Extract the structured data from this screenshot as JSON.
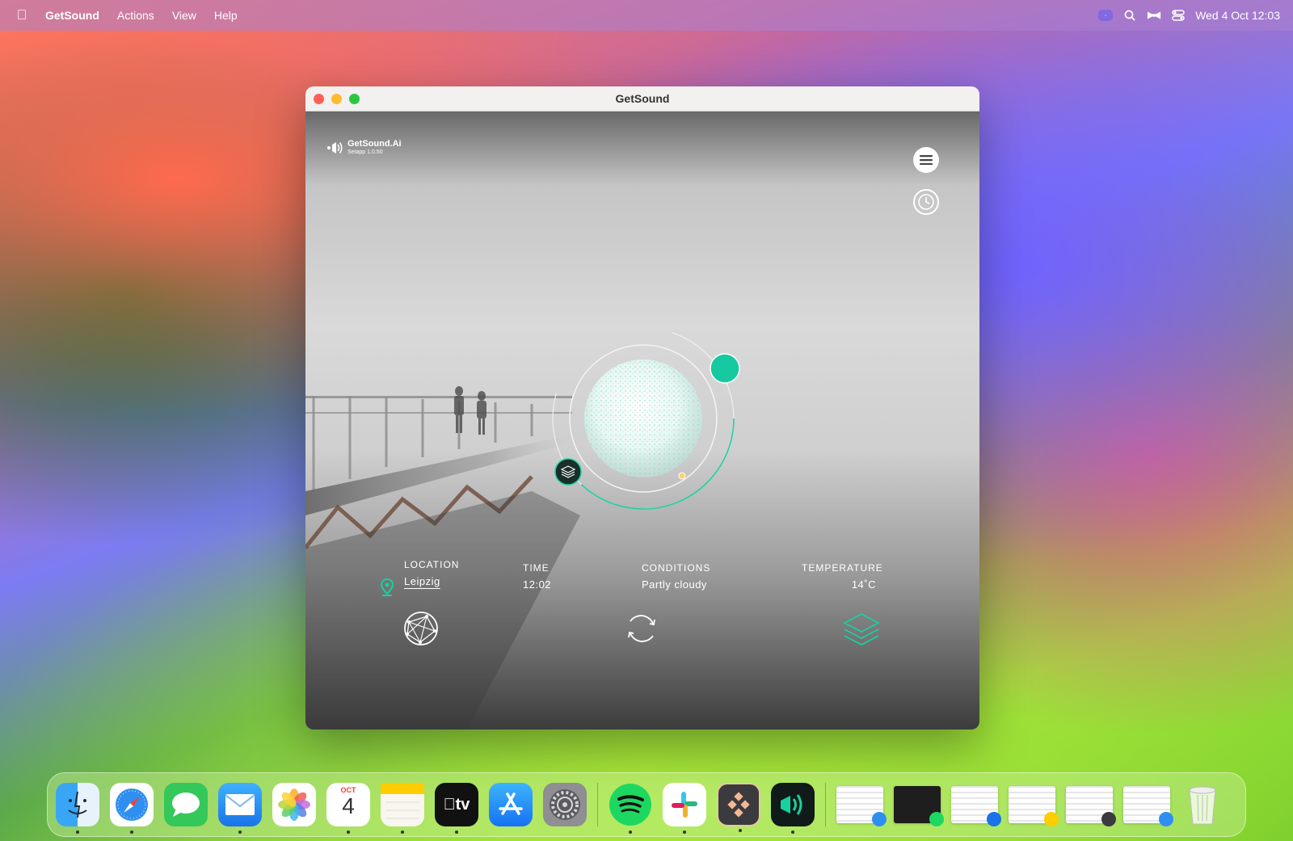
{
  "menubar": {
    "app_name": "GetSound",
    "menus": [
      "Actions",
      "View",
      "Help"
    ],
    "clock": "Wed 4 Oct  12:03"
  },
  "window": {
    "title": "GetSound"
  },
  "app": {
    "brand_name": "GetSound.Ai",
    "brand_version": "Setapp 1.0.50",
    "location": {
      "label": "LOCATION",
      "value": "Leipzig"
    },
    "time": {
      "label": "TIME",
      "value": "12:02"
    },
    "conditions": {
      "label": "CONDITIONS",
      "value": "Partly cloudy"
    },
    "temperature": {
      "label": "TEMPERATURE",
      "value": "14˚C"
    },
    "accent_color": "#17d1a0"
  },
  "dock": {
    "calendar_month": "OCT",
    "calendar_day": "4",
    "tv_label": "tv"
  }
}
